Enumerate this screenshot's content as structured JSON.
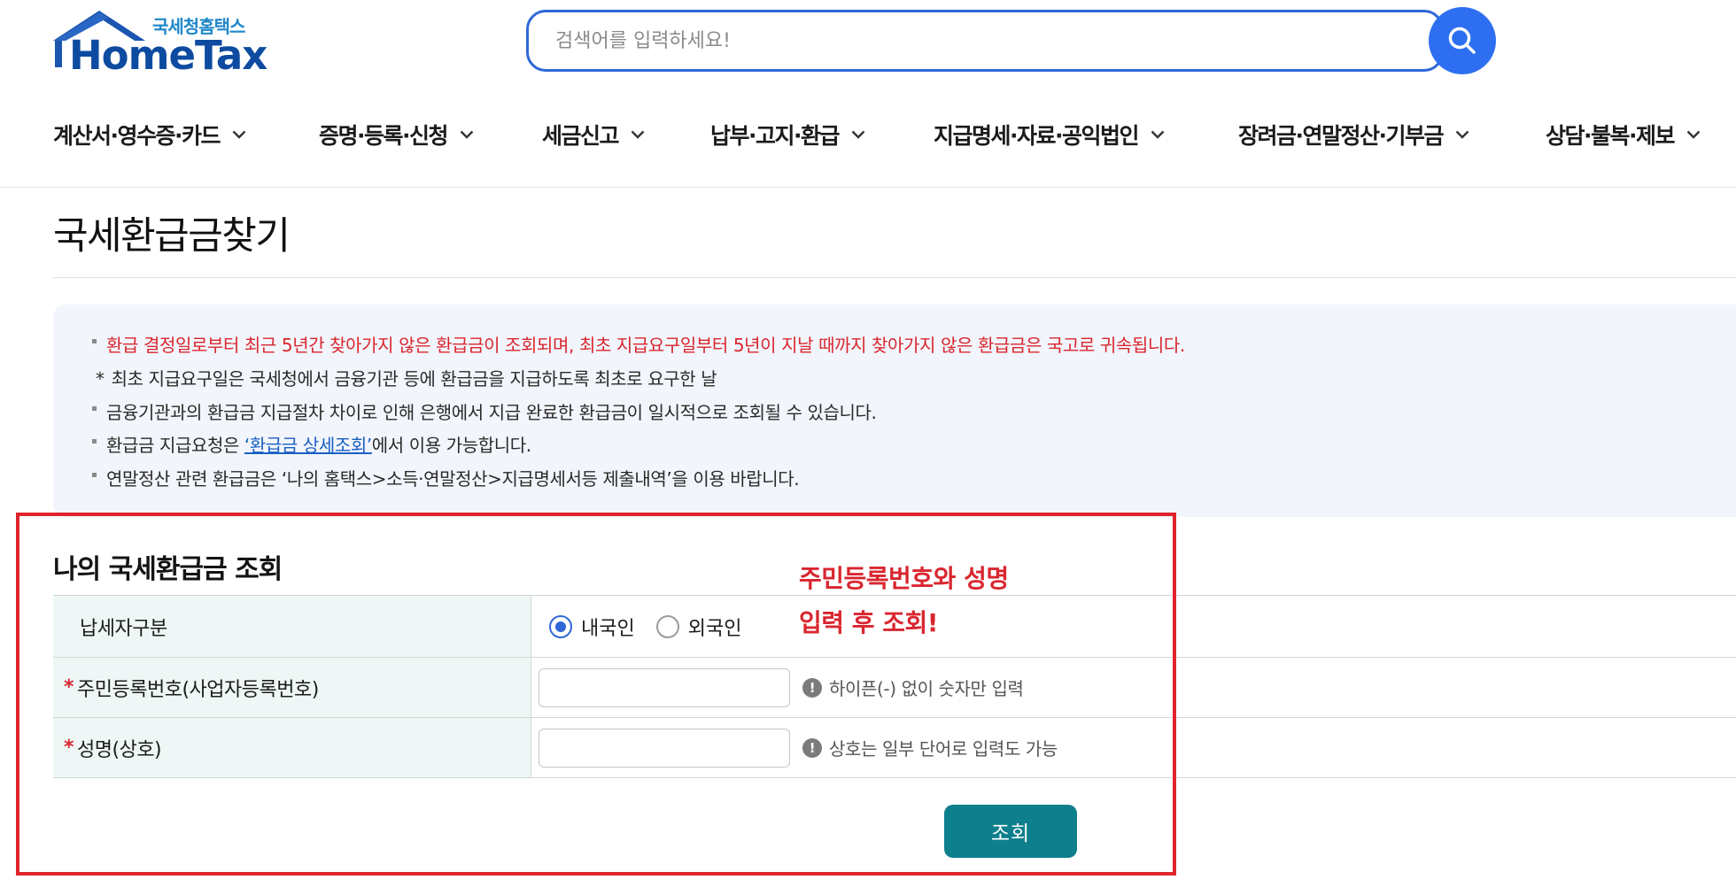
{
  "logo": {
    "sub": "국세청홈택스",
    "main": "HomeTax"
  },
  "search": {
    "placeholder": "검색어를 입력하세요!"
  },
  "nav": [
    "계산서·영수증·카드",
    "증명·등록·신청",
    "세금신고",
    "납부·고지·환급",
    "지급명세·자료·공익법인",
    "장려금·연말정산·기부금",
    "상담·불복·제보"
  ],
  "page": {
    "title": "국세환급금찾기"
  },
  "notice": {
    "line1": "환급 결정일로부터 최근 5년간 찾아가지 않은 환급금이 조회되며, 최초 지급요구일부터 5년이 지날 때까지 찾아가지 않은 환급금은 국고로 귀속됩니다.",
    "line2_mark": "*",
    "line2": "최초 지급요구일은 국세청에서 금융기관 등에 환급금을 지급하도록 최초로 요구한 날",
    "line3": "금융기관과의 환급금 지급절차 차이로 인해 은행에서 지급 완료한 환급금이 일시적으로 조회될 수 있습니다.",
    "line4_pre": "환급금 지급요청은 ",
    "line4_link": "‘환급금 상세조회’",
    "line4_post": "에서 이용 가능합니다.",
    "line5": "연말정산 관련 환급금은 ‘나의 홈택스>소득·연말정산>지급명세서등 제출내역’을 이용 바랍니다."
  },
  "form": {
    "title": "나의 국세환급금 조회",
    "annotation_line1": "주민등록번호와 성명",
    "annotation_line2": "입력 후 조회!",
    "taxpayer_type_label": "납세자구분",
    "radio_domestic": "내국인",
    "radio_foreign": "외국인",
    "selected": "내국인",
    "required_mark": "*",
    "id_label": "주민등록번호(사업자등록번호)",
    "id_value": "",
    "id_hint": "하이픈(-) 없이 숫자만 입력",
    "name_label": "성명(상호)",
    "name_value": "",
    "name_hint": "상호는 일부 단어로 입력도 가능",
    "info_mark": "!",
    "submit_label": "조회"
  },
  "colors": {
    "brand_blue": "#2f67d8",
    "logo_blue": "#0d4ba0",
    "warning_red": "#d9262f",
    "submit_teal": "#0e7f8c",
    "label_bg": "#eef7f5",
    "notice_bg": "#f2f5fb"
  },
  "icons": {
    "search": "search-icon",
    "nav_chevron": "chevron-down-icon",
    "info": "info-icon",
    "logo_roof": "house-roof-icon"
  }
}
